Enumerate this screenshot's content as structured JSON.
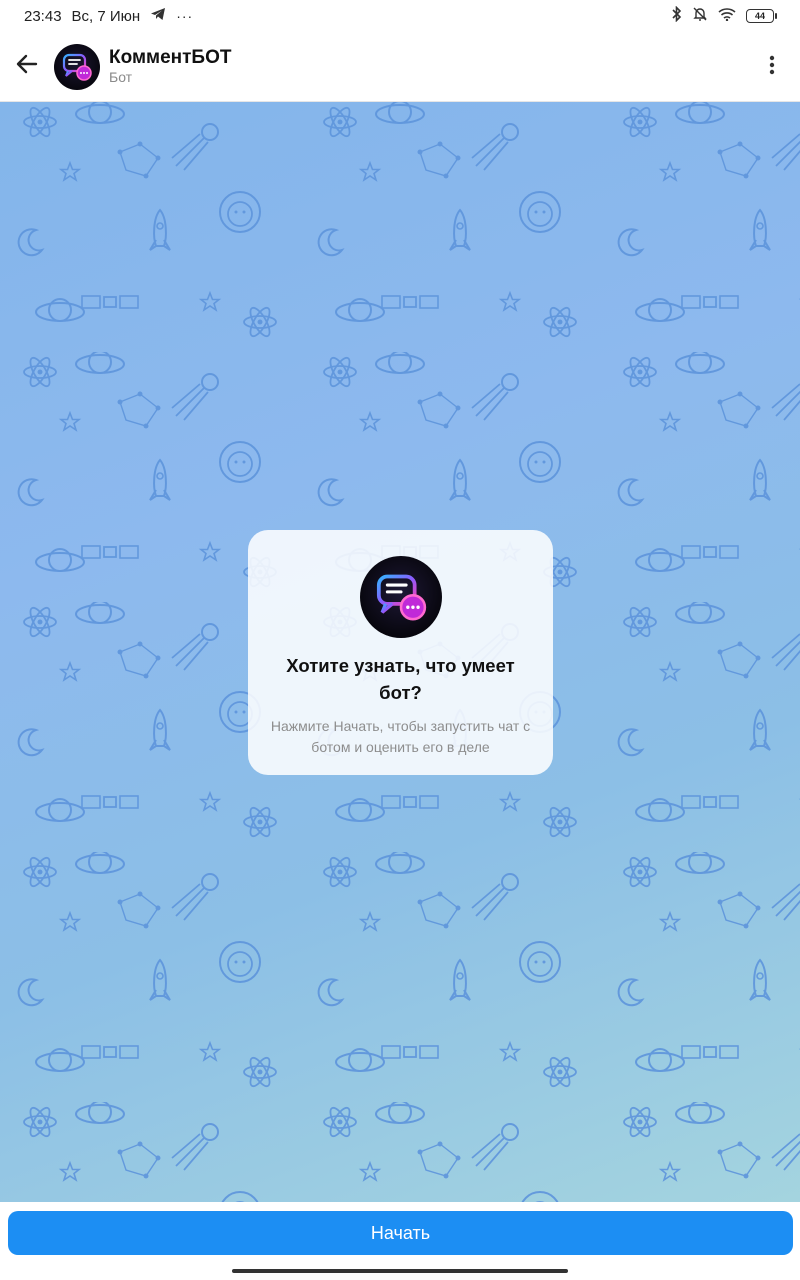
{
  "status_bar": {
    "time": "23:43",
    "date": "Вс, 7 Июн",
    "battery": "44",
    "icons": [
      "telegram-icon",
      "more-icon",
      "bluetooth-icon",
      "mute-icon",
      "wifi-icon",
      "battery-icon"
    ]
  },
  "header": {
    "title": "КомментБОТ",
    "subtitle": "Бот"
  },
  "intro_card": {
    "heading": "Хотите узнать, что умеет бот?",
    "text": "Нажмите Начать, чтобы запустить чат с ботом и оценить его в деле"
  },
  "bottom": {
    "start_label": "Начать"
  },
  "colors": {
    "accent": "#1c8ef3",
    "chat_bg_top": "#83b5ea",
    "chat_bg_bottom": "#a4d4df"
  }
}
